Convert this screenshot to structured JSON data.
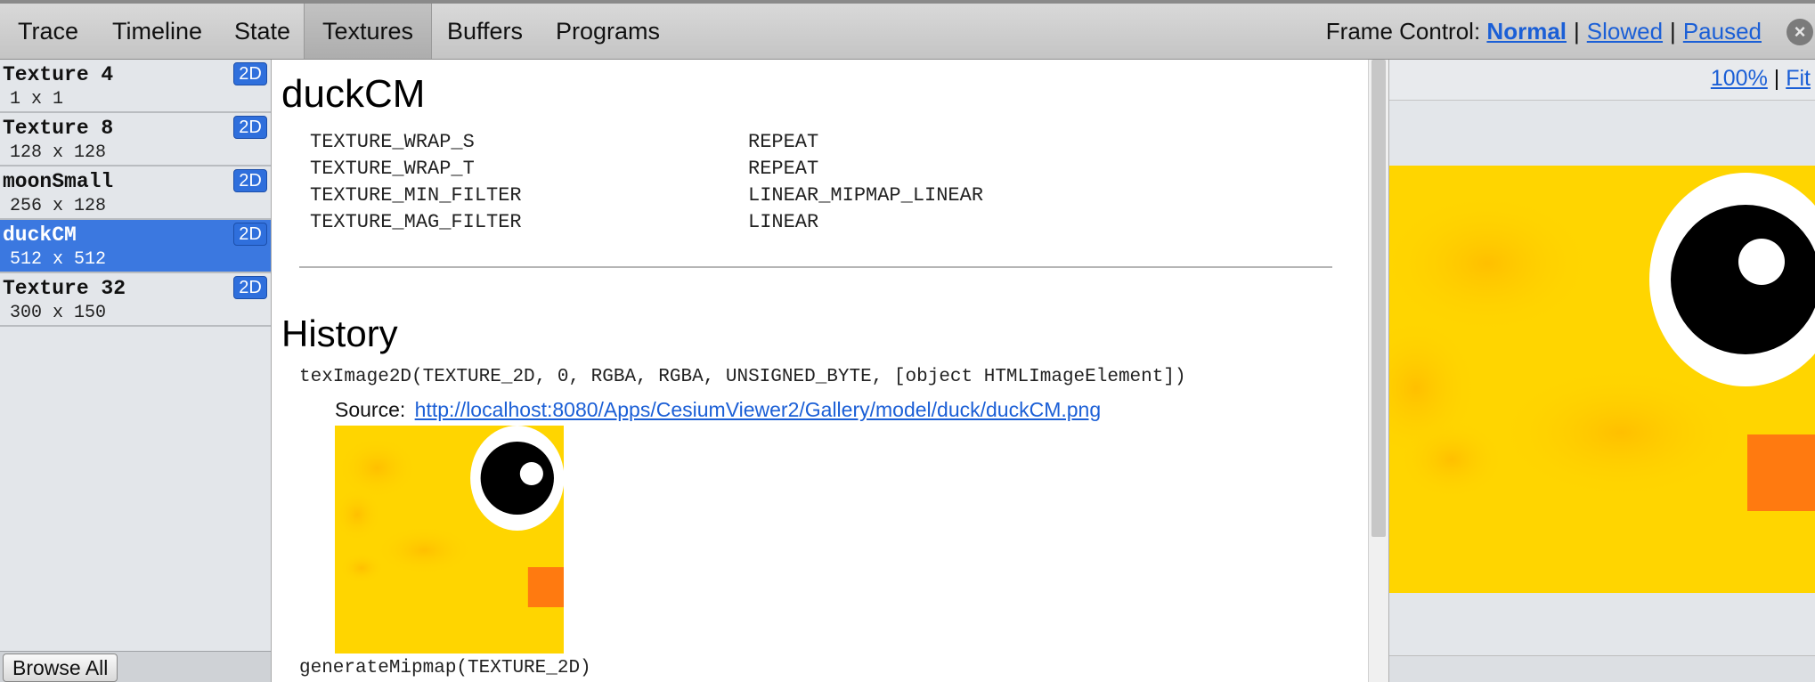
{
  "tabs": [
    {
      "label": "Trace"
    },
    {
      "label": "Timeline"
    },
    {
      "label": "State"
    },
    {
      "label": "Textures"
    },
    {
      "label": "Buffers"
    },
    {
      "label": "Programs"
    }
  ],
  "frame_control": {
    "label": "Frame Control:",
    "options": [
      "Normal",
      "Slowed",
      "Paused"
    ],
    "selected": "Normal",
    "separator": "|"
  },
  "textures": [
    {
      "name": "Texture 4",
      "size": "1 x 1",
      "type": "2D",
      "selected": false
    },
    {
      "name": "Texture 8",
      "size": "128 x 128",
      "type": "2D",
      "selected": false
    },
    {
      "name": "moonSmall",
      "size": "256 x 128",
      "type": "2D",
      "selected": false
    },
    {
      "name": "duckCM",
      "size": "512 x 512",
      "type": "2D",
      "selected": true
    },
    {
      "name": "Texture 32",
      "size": "300 x 150",
      "type": "2D",
      "selected": false
    }
  ],
  "browse_all_label": "Browse All",
  "detail": {
    "title": "duckCM",
    "properties": [
      {
        "key": "TEXTURE_WRAP_S",
        "value": "REPEAT"
      },
      {
        "key": "TEXTURE_WRAP_T",
        "value": "REPEAT"
      },
      {
        "key": "TEXTURE_MIN_FILTER",
        "value": "LINEAR_MIPMAP_LINEAR"
      },
      {
        "key": "TEXTURE_MAG_FILTER",
        "value": "LINEAR"
      }
    ],
    "history_title": "History",
    "calls": [
      "texImage2D(TEXTURE_2D, 0, RGBA, RGBA, UNSIGNED_BYTE, [object HTMLImageElement])",
      "generateMipmap(TEXTURE_2D)"
    ],
    "source_label": "Source:",
    "source_url": "http://localhost:8080/Apps/CesiumViewer2/Gallery/model/duck/duckCM.png"
  },
  "preview": {
    "zoom_label": "100%",
    "fit_label": "Fit",
    "separator": "|"
  },
  "colors": {
    "selected_row": "#3b78e0",
    "link": "#1b5fd6",
    "duck_yellow": "#ffd500",
    "duck_orange": "#ff7a10"
  },
  "icons": [
    "close-icon"
  ]
}
